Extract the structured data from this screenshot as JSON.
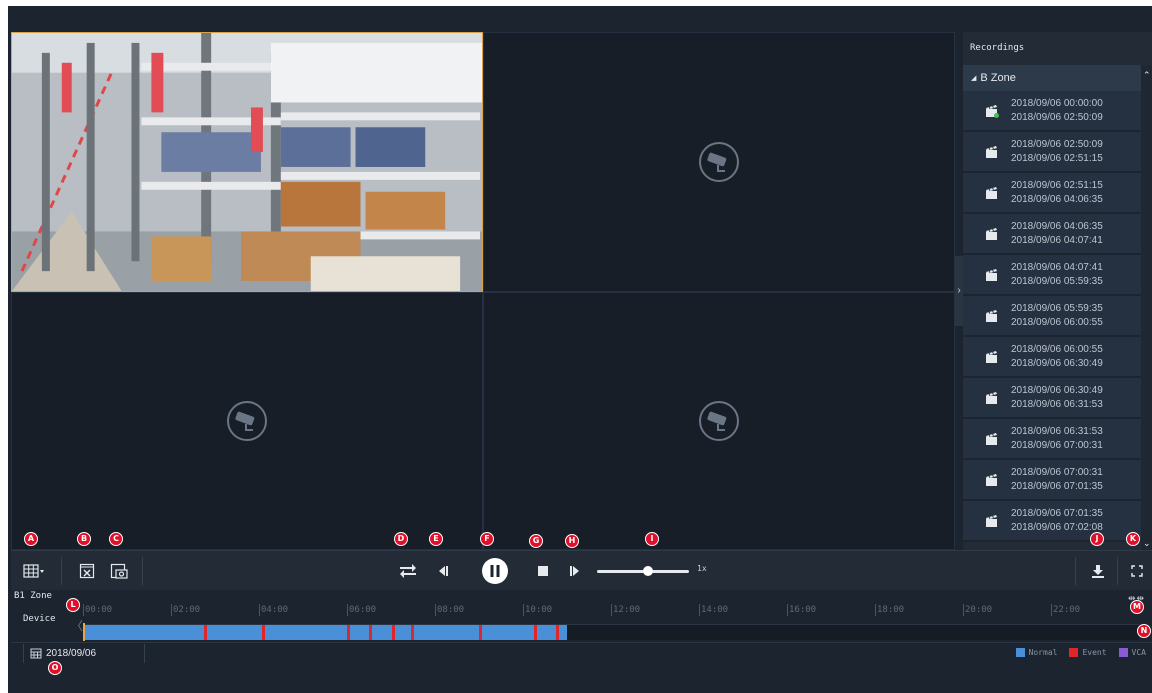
{
  "recordings": {
    "title": "Recordings",
    "zone": "B Zone",
    "items": [
      {
        "start": "2018/09/06  00:00:00",
        "end": "2018/09/06  02:50:09",
        "playing": true
      },
      {
        "start": "2018/09/06  02:50:09",
        "end": "2018/09/06  02:51:15",
        "playing": false
      },
      {
        "start": "2018/09/06  02:51:15",
        "end": "2018/09/06  04:06:35",
        "playing": false
      },
      {
        "start": "2018/09/06  04:06:35",
        "end": "2018/09/06  04:07:41",
        "playing": false
      },
      {
        "start": "2018/09/06  04:07:41",
        "end": "2018/09/06  05:59:35",
        "playing": false
      },
      {
        "start": "2018/09/06  05:59:35",
        "end": "2018/09/06  06:00:55",
        "playing": false
      },
      {
        "start": "2018/09/06  06:00:55",
        "end": "2018/09/06  06:30:49",
        "playing": false
      },
      {
        "start": "2018/09/06  06:30:49",
        "end": "2018/09/06  06:31:53",
        "playing": false
      },
      {
        "start": "2018/09/06  06:31:53",
        "end": "2018/09/06  07:00:31",
        "playing": false
      },
      {
        "start": "2018/09/06  07:00:31",
        "end": "2018/09/06  07:01:35",
        "playing": false
      },
      {
        "start": "2018/09/06  07:01:35",
        "end": "2018/09/06  07:02:08",
        "playing": false
      }
    ]
  },
  "toolbar": {
    "speed_label": "1x",
    "speed_fraction": 0.55,
    "state": "playing"
  },
  "timeline": {
    "zone_label": "B1 Zone",
    "device_label": "Device",
    "ticks": [
      "00:00",
      "02:00",
      "04:00",
      "06:00",
      "08:00",
      "10:00",
      "12:00",
      "14:00",
      "16:00",
      "18:00",
      "20:00",
      "22:00"
    ],
    "normal_range_hours": [
      0,
      11.0
    ],
    "event_marks_hours": [
      2.75,
      4.07,
      6.0,
      6.5,
      7.03,
      7.45,
      9.0,
      10.25,
      10.75
    ],
    "cursor_hours": 0.0
  },
  "date": {
    "value": "2018/09/06"
  },
  "legend": [
    {
      "label": "Normal",
      "color": "#4a90d9"
    },
    {
      "label": "Event",
      "color": "#e0262a"
    },
    {
      "label": "VCA",
      "color": "#8b5ad6"
    }
  ],
  "colors": {
    "accent_border": "#d9a24a",
    "callout": "#e0102a"
  },
  "callouts": [
    "A",
    "B",
    "C",
    "D",
    "E",
    "F",
    "G",
    "H",
    "I",
    "J",
    "K",
    "L",
    "M",
    "N",
    "O"
  ]
}
